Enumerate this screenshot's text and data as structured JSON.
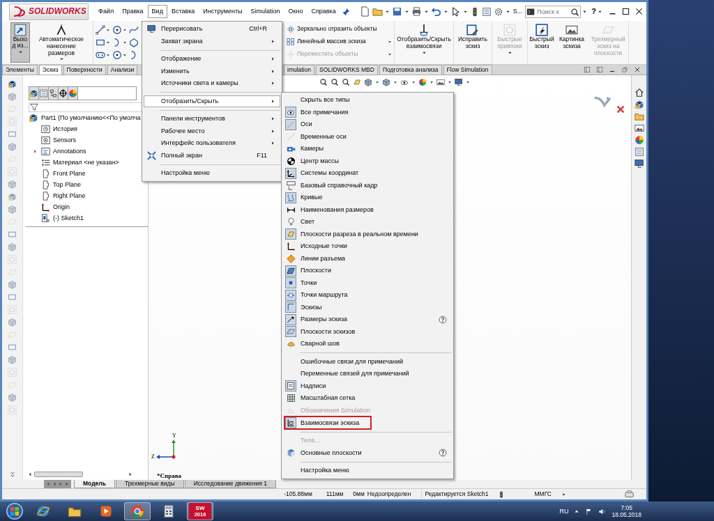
{
  "title_bar": {
    "logo": "SOLIDWORKS",
    "menu": [
      {
        "label": "Файл",
        "selected": false
      },
      {
        "label": "Правка",
        "selected": false
      },
      {
        "label": "Вид",
        "selected": true
      },
      {
        "label": "Вставка",
        "selected": false
      },
      {
        "label": "Инструменты",
        "selected": false
      },
      {
        "label": "Simulation",
        "selected": false
      },
      {
        "label": "Окно",
        "selected": false
      },
      {
        "label": "Справка",
        "selected": false
      }
    ],
    "quick_label": "S...",
    "search": {
      "placeholder": "Поиск к"
    },
    "help": "?"
  },
  "ribbon": {
    "exit_button": {
      "label": "Выход из...",
      "pressed": true
    },
    "auto_dimension": "Автоматическое нанесение размеров",
    "list_tools": [
      {
        "label": "Зеркально отразить объекты",
        "disabled": false
      },
      {
        "label": "Линейный массив эскиза",
        "disabled": false
      },
      {
        "label": "Переместить объекты",
        "disabled": true
      }
    ],
    "buttons": [
      {
        "label": "Отобразить/Скрыть взаимосвязи",
        "disabled": false
      },
      {
        "label": "Исправить эскиз",
        "disabled": false
      },
      {
        "label": "Быстрые привязки",
        "disabled": true
      },
      {
        "label": "Быстрый эскиз",
        "disabled": false
      },
      {
        "label": "Картинка эскиза",
        "disabled": false
      },
      {
        "label": "Трехмерный эскиз на плоскости",
        "disabled": true
      }
    ]
  },
  "command_tabs": [
    {
      "label": "Элементы",
      "selected": false
    },
    {
      "label": "Эскиз",
      "selected": true
    },
    {
      "label": "Поверхности",
      "selected": false
    },
    {
      "label": "Анализи",
      "selected": false
    },
    {
      "label": "imulation",
      "selected": false
    },
    {
      "label": "SOLIDWORKS MBD",
      "selected": false
    },
    {
      "label": "Подготовка анализа",
      "selected": false
    },
    {
      "label": "Flow Simulation",
      "selected": false
    }
  ],
  "feature_tree": {
    "root": {
      "label": "Part1  (По умолчанию<<По умолча",
      "children": [
        {
          "label": "История"
        },
        {
          "label": "Sensors"
        },
        {
          "label": "Annotations",
          "expanded": false
        },
        {
          "label": "Материал <не указан>"
        },
        {
          "label": "Front Plane"
        },
        {
          "label": "Top Plane"
        },
        {
          "label": "Right Plane"
        },
        {
          "label": "Origin"
        },
        {
          "label": "(-) Sketch1"
        }
      ]
    }
  },
  "view_menu": {
    "items": [
      {
        "kind": "item",
        "label": "Перерисовать",
        "shortcut": "Ctrl+R",
        "submenu": false,
        "selected": false
      },
      {
        "kind": "item",
        "label": "Захват экрана",
        "submenu": true,
        "selected": false
      },
      {
        "kind": "separator"
      },
      {
        "kind": "item",
        "label": "Отображение",
        "submenu": true,
        "selected": false
      },
      {
        "kind": "item",
        "label": "Изменить",
        "submenu": true,
        "selected": false
      },
      {
        "kind": "item",
        "label": "Источники света и камеры",
        "submenu": true,
        "selected": false
      },
      {
        "kind": "separator"
      },
      {
        "kind": "item",
        "label": "Отобразить/Скрыть",
        "submenu": true,
        "selected": true
      },
      {
        "kind": "separator"
      },
      {
        "kind": "item",
        "label": "Панели инструментов",
        "submenu": true,
        "selected": false
      },
      {
        "kind": "item",
        "label": "Рабочее место",
        "submenu": true,
        "selected": false
      },
      {
        "kind": "item",
        "label": "Интерфейс пользователя",
        "submenu": true,
        "selected": false
      },
      {
        "kind": "item",
        "label": "Полный экран",
        "shortcut": "F11",
        "submenu": false,
        "selected": false
      },
      {
        "kind": "separator"
      },
      {
        "kind": "item",
        "label": "Настройка меню",
        "submenu": false,
        "selected": false
      }
    ]
  },
  "show_hide_menu": {
    "items": [
      {
        "kind": "item",
        "label": "Скрыть все типы",
        "checked": false,
        "disabled": false
      },
      {
        "kind": "item",
        "label": "Все примечания",
        "checked": true,
        "disabled": false
      },
      {
        "kind": "item",
        "label": "Оси",
        "checked": true,
        "disabled": false
      },
      {
        "kind": "item",
        "label": "Временные оси",
        "checked": false,
        "disabled": false
      },
      {
        "kind": "item",
        "label": "Камеры",
        "checked": false,
        "disabled": false
      },
      {
        "kind": "item",
        "label": "Центр массы",
        "checked": false,
        "disabled": false
      },
      {
        "kind": "item",
        "label": "Системы координат",
        "checked": true,
        "disabled": false
      },
      {
        "kind": "item",
        "label": "Базовый справочный кадр",
        "checked": false,
        "disabled": false
      },
      {
        "kind": "item",
        "label": "Кривые",
        "checked": true,
        "disabled": false
      },
      {
        "kind": "item",
        "label": "Наименования размеров",
        "checked": false,
        "disabled": false
      },
      {
        "kind": "item",
        "label": "Свет",
        "checked": false,
        "disabled": false
      },
      {
        "kind": "item",
        "label": "Плоскости разреза в реальном времени",
        "checked": true,
        "disabled": false
      },
      {
        "kind": "item",
        "label": "Исходные точки",
        "checked": false,
        "disabled": false
      },
      {
        "kind": "item",
        "label": "Линии разъема",
        "checked": false,
        "disabled": false
      },
      {
        "kind": "item",
        "label": "Плоскости",
        "checked": true,
        "disabled": false
      },
      {
        "kind": "item",
        "label": "Точки",
        "checked": true,
        "disabled": false
      },
      {
        "kind": "item",
        "label": "Точки маршрута",
        "checked": true,
        "disabled": false
      },
      {
        "kind": "item",
        "label": "Эскизы",
        "checked": true,
        "disabled": false
      },
      {
        "kind": "item",
        "label": "Размеры эскиза",
        "checked": true,
        "disabled": false,
        "help": true
      },
      {
        "kind": "item",
        "label": "Плоскости эскизов",
        "checked": true,
        "disabled": false
      },
      {
        "kind": "item",
        "label": "Сварной шов",
        "checked": false,
        "disabled": false
      },
      {
        "kind": "separator"
      },
      {
        "kind": "item",
        "label": "Ошибочные связи для примечаний",
        "checked": false,
        "disabled": false
      },
      {
        "kind": "item",
        "label": "Переменные связей для примечаний",
        "checked": false,
        "disabled": false
      },
      {
        "kind": "item",
        "label": "Надписи",
        "checked": true,
        "disabled": false
      },
      {
        "kind": "item",
        "label": "Масштабная сетка",
        "checked": false,
        "disabled": false
      },
      {
        "kind": "item",
        "label": "Обозначения Simulation",
        "checked": false,
        "disabled": true
      },
      {
        "kind": "item",
        "label": "Взаимосвязи эскиза",
        "checked": true,
        "disabled": false,
        "highlighted": true
      },
      {
        "kind": "separator"
      },
      {
        "kind": "item",
        "label": "Тела...",
        "checked": false,
        "disabled": true
      },
      {
        "kind": "item",
        "label": "Основные плоскости",
        "checked": false,
        "disabled": false,
        "help": true
      },
      {
        "kind": "separator"
      },
      {
        "kind": "item",
        "label": "Настройка меню",
        "checked": false,
        "disabled": false
      }
    ]
  },
  "graphics": {
    "axis_labels": [
      "Y",
      "Z"
    ],
    "view_label": "*Справа"
  },
  "bottom_tabs": [
    {
      "label": "Модель",
      "selected": true
    },
    {
      "label": "Трехмерные виды",
      "selected": false
    },
    {
      "label": "Исследование движения 1",
      "selected": false
    }
  ],
  "status_bar": [
    "-105.88мм",
    "111мм",
    "0мм",
    "Недоопределен",
    "Редактируется Sketch1",
    "ММГС"
  ],
  "taskbar": {
    "app_badge": [
      "SW",
      "2016"
    ],
    "language": "RU",
    "time": "7:05",
    "date": "18.05.2018"
  }
}
